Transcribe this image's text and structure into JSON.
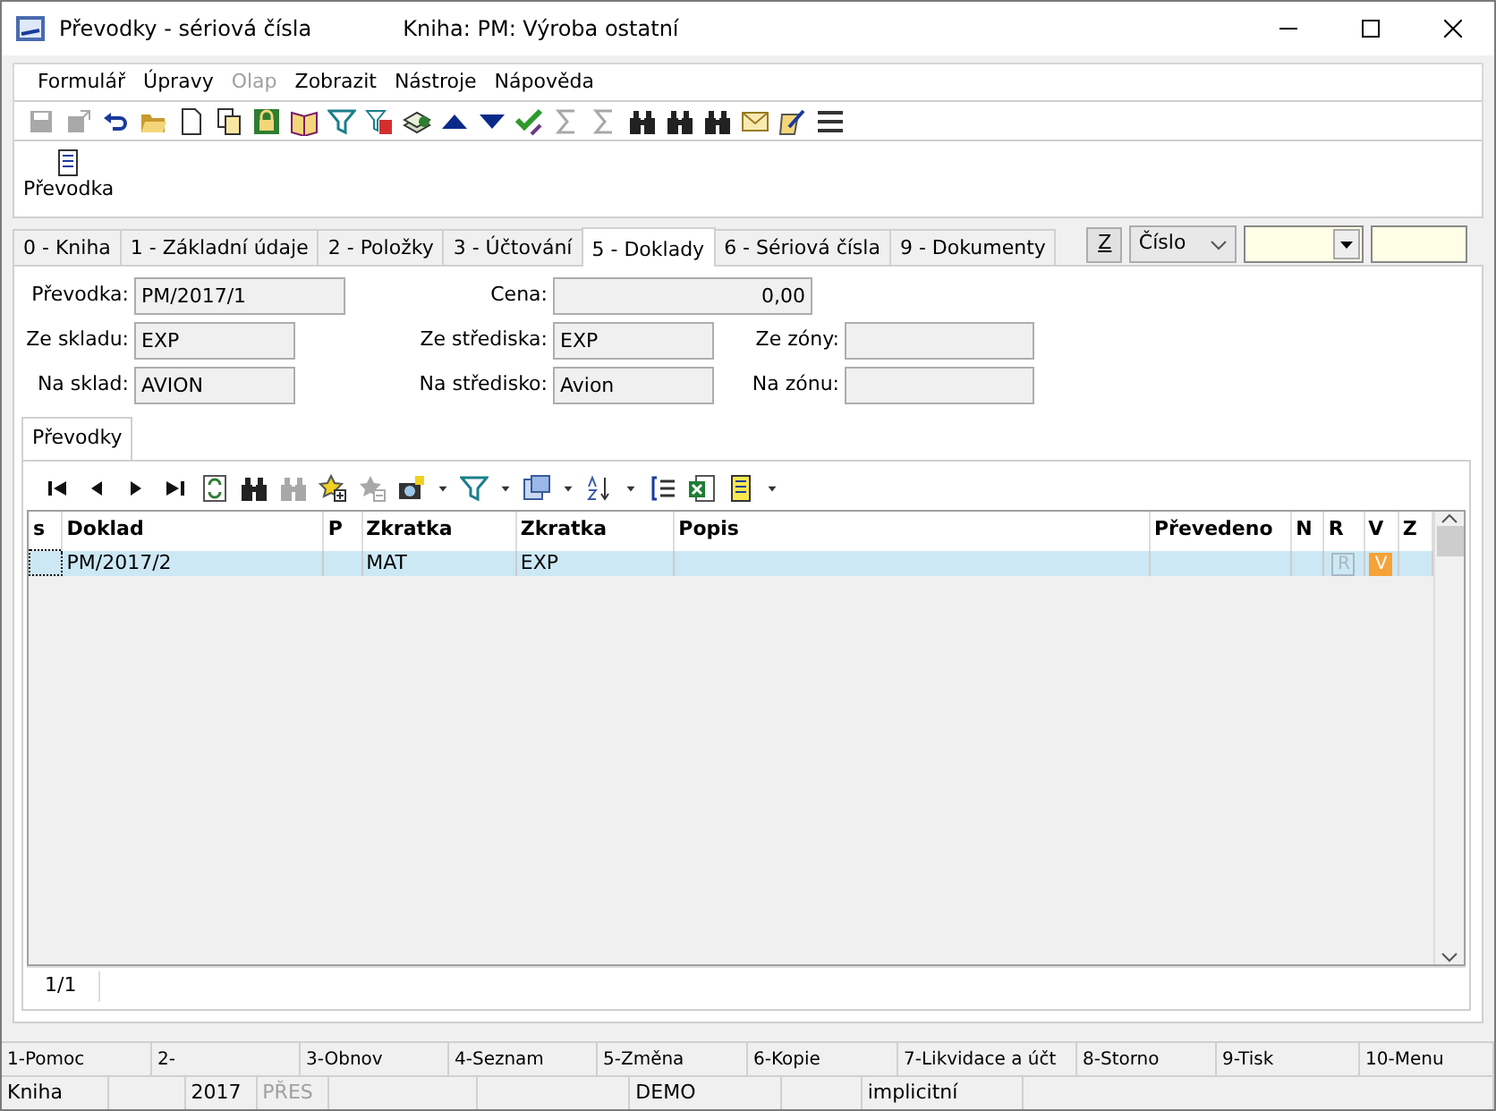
{
  "window": {
    "title": "Převodky - sériová čísla",
    "subtitle": "Kniha: PM: Výroba ostatní"
  },
  "menu": [
    {
      "label": "Formulář",
      "disabled": false
    },
    {
      "label": "Úpravy",
      "disabled": false
    },
    {
      "label": "Olap",
      "disabled": true
    },
    {
      "label": "Zobrazit",
      "disabled": false
    },
    {
      "label": "Nástroje",
      "disabled": false
    },
    {
      "label": "Nápověda",
      "disabled": false
    }
  ],
  "toolbar": [
    {
      "kind": "save",
      "disabled": true
    },
    {
      "kind": "export",
      "disabled": true
    },
    {
      "kind": "undo",
      "disabled": false
    },
    {
      "kind": "folder",
      "disabled": false
    },
    {
      "kind": "page",
      "disabled": false
    },
    {
      "kind": "copy",
      "disabled": false
    },
    {
      "kind": "lock",
      "disabled": false
    },
    {
      "kind": "book",
      "disabled": false
    },
    {
      "kind": "filter",
      "disabled": false
    },
    {
      "kind": "filterdoc",
      "disabled": false
    },
    {
      "kind": "money",
      "disabled": false
    },
    {
      "kind": "up",
      "disabled": false
    },
    {
      "kind": "down",
      "disabled": false
    },
    {
      "kind": "checkpen",
      "disabled": false
    },
    {
      "kind": "sigma",
      "disabled": true
    },
    {
      "kind": "sigma",
      "disabled": true
    },
    {
      "kind": "binoculars",
      "disabled": false
    },
    {
      "kind": "binoculars",
      "disabled": false
    },
    {
      "kind": "binoculars",
      "disabled": false
    },
    {
      "kind": "mail",
      "disabled": false
    },
    {
      "kind": "notepad",
      "disabled": false
    },
    {
      "kind": "lines",
      "disabled": false
    }
  ],
  "big_button": {
    "label": "Převodka"
  },
  "tabs": [
    {
      "label": "0 - Kniha",
      "selected": false
    },
    {
      "label": "1 - Základní údaje",
      "selected": false
    },
    {
      "label": "2 - Položky",
      "selected": false
    },
    {
      "label": "3 - Účtování",
      "selected": false
    },
    {
      "label": "5 - Doklady",
      "selected": true
    },
    {
      "label": "6 - Sériová čísla",
      "selected": false
    },
    {
      "label": "9 - Dokumenty",
      "selected": false
    }
  ],
  "search": {
    "button": "Z",
    "field": "Číslo"
  },
  "form": [
    {
      "label": "Převodka:",
      "value": "PM/2017/1"
    },
    {
      "label": "Cena:",
      "value": "0,00"
    },
    {
      "label": "Ze skladu:",
      "value": "EXP"
    },
    {
      "label": "Ze střediska:",
      "value": "EXP"
    },
    {
      "label": "Ze zóny:"
    },
    {
      "label": "Na sklad:",
      "value": "AVION"
    },
    {
      "label": "Na středisko:",
      "value": "Avion"
    },
    {
      "label": "Na zónu:"
    }
  ],
  "inner_tab": {
    "label": "Převodky",
    "selected": true
  },
  "grid_toolbar": [
    {
      "kind": "first",
      "disabled": false
    },
    {
      "kind": "prev",
      "disabled": false
    },
    {
      "kind": "next",
      "disabled": false
    },
    {
      "kind": "last",
      "disabled": false
    },
    {
      "kind": "refresh",
      "disabled": false
    },
    {
      "kind": "binoculars",
      "disabled": false
    },
    {
      "kind": "binoculars",
      "disabled": true
    },
    {
      "kind": "staradd",
      "disabled": false
    },
    {
      "kind": "starremove",
      "disabled": true
    },
    {
      "kind": "camera",
      "disabled": false
    },
    {
      "kind": "caret",
      "disabled": false
    },
    {
      "kind": "filter",
      "disabled": false
    },
    {
      "kind": "caret",
      "disabled": false
    },
    {
      "kind": "columns",
      "disabled": false
    },
    {
      "kind": "caret",
      "disabled": false
    },
    {
      "kind": "sort",
      "disabled": false
    },
    {
      "kind": "caret",
      "disabled": false
    },
    {
      "kind": "brace",
      "disabled": false
    },
    {
      "kind": "excel",
      "disabled": false
    },
    {
      "kind": "report",
      "disabled": false
    },
    {
      "kind": "caret",
      "disabled": false
    }
  ],
  "table": {
    "columns": [
      "s",
      "Doklad",
      "P",
      "Zkratka",
      "Zkratka",
      "Popis",
      "Převedeno",
      "N",
      "R",
      "V",
      "Z"
    ],
    "rows": [
      {
        "selected": true,
        "doklad": "PM/2017/2",
        "zkratka_1": "MAT",
        "zkratka_2": "EXP",
        "r": {
          "text": "R",
          "on": false
        },
        "v": {
          "text": "V",
          "on": true
        }
      }
    ]
  },
  "record_count": "1/1",
  "function_keys": [
    "1-Pomoc",
    "2-",
    "3-Obnov",
    "4-Seznam",
    "5-Změna",
    "6-Kopie",
    "7-Likvidace a účt",
    "8-Storno",
    "9-Tisk",
    "10-Menu"
  ],
  "status_bar": [
    {
      "text": "Kniha",
      "disabled": false
    },
    {
      "text": "2017",
      "disabled": false
    },
    {
      "text": "PŘES",
      "disabled": true
    },
    {
      "text": "DEMO",
      "disabled": false
    },
    {
      "text": "implicitní",
      "disabled": false
    }
  ]
}
